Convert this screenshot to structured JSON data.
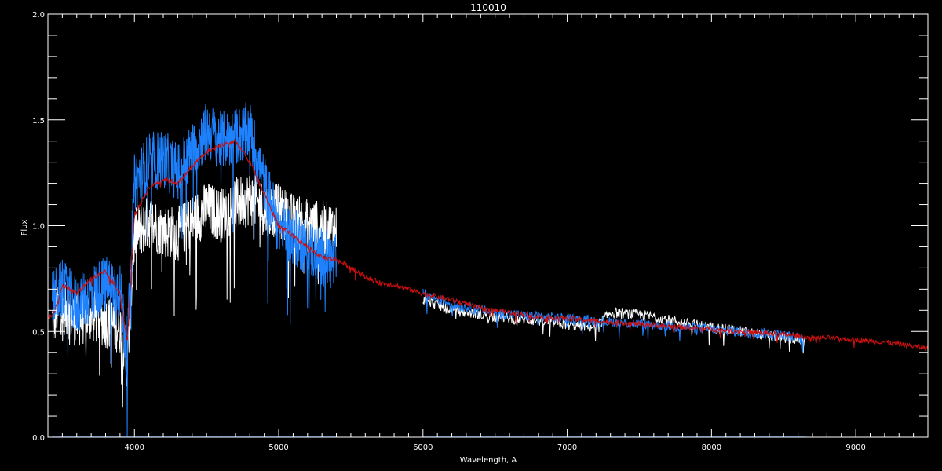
{
  "chart_data": {
    "type": "line",
    "title": "110010",
    "xlabel": "Wavelength, A",
    "ylabel": "Flux",
    "xlim": [
      3400,
      9500
    ],
    "ylim": [
      0.0,
      2.0
    ],
    "x_ticks": [
      4000,
      5000,
      6000,
      7000,
      8000,
      9000
    ],
    "x_tick_labels": [
      "4000",
      "5000",
      "6000",
      "7000",
      "8000",
      "9000"
    ],
    "y_ticks": [
      0.0,
      0.5,
      1.0,
      1.5,
      2.0
    ],
    "y_tick_labels": [
      "0.0",
      "0.5",
      "1.0",
      "1.5",
      "2.0"
    ],
    "grid": false,
    "series": [
      {
        "color": "#ffffff",
        "segments": [
          {
            "x": [
              3430,
              3500,
              3600,
              3700,
              3800,
              3900,
              3950,
              4000,
              4100,
              4200,
              4300,
              4400,
              4500,
              4600,
              4700,
              4800,
              4900,
              5000,
              5100,
              5200,
              5300,
              5400
            ],
            "y": [
              0.55,
              0.62,
              0.55,
              0.58,
              0.55,
              0.52,
              0.35,
              0.95,
              1.02,
              0.98,
              0.96,
              1.02,
              1.08,
              1.05,
              1.1,
              1.13,
              1.08,
              1.07,
              1.02,
              1.0,
              0.99,
              0.98
            ],
            "noise": 0.13
          },
          {
            "x": [
              6000,
              6200,
              6400,
              6600,
              6800,
              7000,
              7200,
              7300,
              7500,
              7600,
              7800,
              8000,
              8200,
              8400,
              8600,
              8650
            ],
            "y": [
              0.65,
              0.6,
              0.58,
              0.56,
              0.55,
              0.53,
              0.52,
              0.59,
              0.58,
              0.57,
              0.54,
              0.52,
              0.5,
              0.48,
              0.46,
              0.45
            ],
            "noise": 0.025
          }
        ]
      },
      {
        "color": "#1e82ff",
        "segments": [
          {
            "x": [
              3430,
              3500,
              3600,
              3700,
              3800,
              3900,
              3950,
              4000,
              4100,
              4200,
              4300,
              4400,
              4500,
              4600,
              4700,
              4800,
              4900,
              5000,
              5100,
              5200,
              5300,
              5400
            ],
            "y": [
              0.65,
              0.7,
              0.62,
              0.68,
              0.72,
              0.7,
              0.4,
              1.2,
              1.3,
              1.32,
              1.25,
              1.35,
              1.45,
              1.4,
              1.42,
              1.45,
              1.2,
              1.0,
              0.95,
              0.9,
              0.85,
              0.82
            ],
            "noise": 0.14
          },
          {
            "x": [
              6000,
              6200,
              6400,
              6600,
              6800,
              7000,
              7200,
              7400,
              7600,
              7800,
              8000,
              8200,
              8400,
              8600,
              8650
            ],
            "y": [
              0.68,
              0.63,
              0.6,
              0.58,
              0.57,
              0.56,
              0.55,
              0.54,
              0.53,
              0.52,
              0.51,
              0.5,
              0.49,
              0.47,
              0.46
            ],
            "noise": 0.025
          },
          {
            "x": [
              3430,
              5400
            ],
            "y": [
              0.005,
              0.005
            ],
            "noise": 0
          },
          {
            "x": [
              6000,
              8650
            ],
            "y": [
              0.005,
              0.005
            ],
            "noise": 0
          }
        ]
      },
      {
        "color": "#cc1010",
        "segments": [
          {
            "x": [
              3400,
              3450,
              3500,
              3600,
              3700,
              3800,
              3900,
              3950,
              4000,
              4100,
              4200,
              4300,
              4400,
              4500,
              4600,
              4700,
              4800,
              4900,
              5000,
              5100,
              5200,
              5300,
              5400,
              5500,
              5600,
              5700,
              5800,
              5900,
              6000,
              6200,
              6400,
              6600,
              6800,
              7000,
              7200,
              7400,
              7600,
              7800,
              8000,
              8200,
              8400,
              8600,
              8700,
              8800,
              9000,
              9200,
              9400,
              9500
            ],
            "y": [
              0.56,
              0.6,
              0.72,
              0.68,
              0.75,
              0.78,
              0.68,
              0.45,
              1.05,
              1.18,
              1.22,
              1.2,
              1.28,
              1.35,
              1.38,
              1.4,
              1.3,
              1.15,
              1.0,
              0.95,
              0.9,
              0.85,
              0.84,
              0.8,
              0.76,
              0.73,
              0.72,
              0.7,
              0.68,
              0.65,
              0.61,
              0.59,
              0.57,
              0.56,
              0.55,
              0.54,
              0.53,
              0.52,
              0.51,
              0.5,
              0.49,
              0.48,
              0.47,
              0.47,
              0.46,
              0.45,
              0.43,
              0.42
            ],
            "noise": 0.012
          }
        ]
      }
    ]
  }
}
